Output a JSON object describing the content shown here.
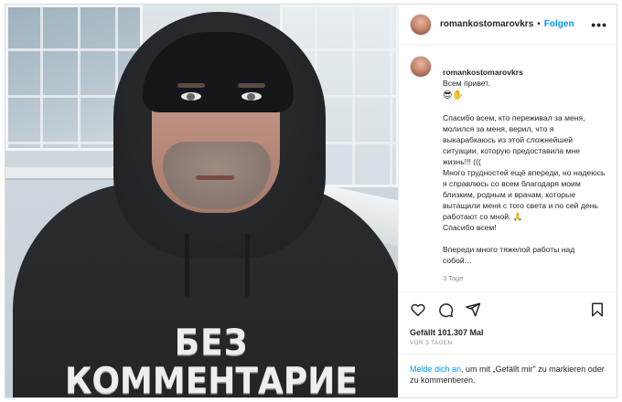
{
  "post": {
    "username": "romankostomarovkrs",
    "separator": "•",
    "follow_label": "Folgen",
    "more_label": "•••",
    "photo": {
      "shirt_line_1": "БЕЗ",
      "shirt_line_2": "КОММЕНТАРИЕ"
    },
    "caption": {
      "username": "romankostomarovkrs",
      "greeting": "Всем привет.",
      "emoji": "😎✋",
      "paragraph_1": "Спасибо всем, кто переживал за меня, молился за меня, верил, что я выкарабкаюсь из этой сложнейшей ситуации, которую предоставила мне жизнь!!! (((\nМного трудностей ещё впереди, но надеюсь я справлюсь со всем благодаря моим близким, родным и врачам, которые вытащили меня с того света и по сей день работают со мной. 🙏\nСпасибо всем!",
      "paragraph_2": "Впереди много тяжелой работы над собой…"
    },
    "time_ago": "3 Tage",
    "likes": "Gefällt 101.307 Mal",
    "date": "VOR 3 TAGEN",
    "actions": {
      "like_icon": "heart-icon",
      "comment_icon": "comment-icon",
      "share_icon": "share-icon",
      "save_icon": "bookmark-icon"
    },
    "login_prompt": {
      "link": "Melde dich an",
      "text": ", um mit „Gefällt mir\" zu markieren oder zu kommentieren."
    }
  },
  "colors": {
    "link_blue": "#0095f6",
    "text": "#262626",
    "muted": "#8e8e8e",
    "border": "#dbdbdb"
  }
}
